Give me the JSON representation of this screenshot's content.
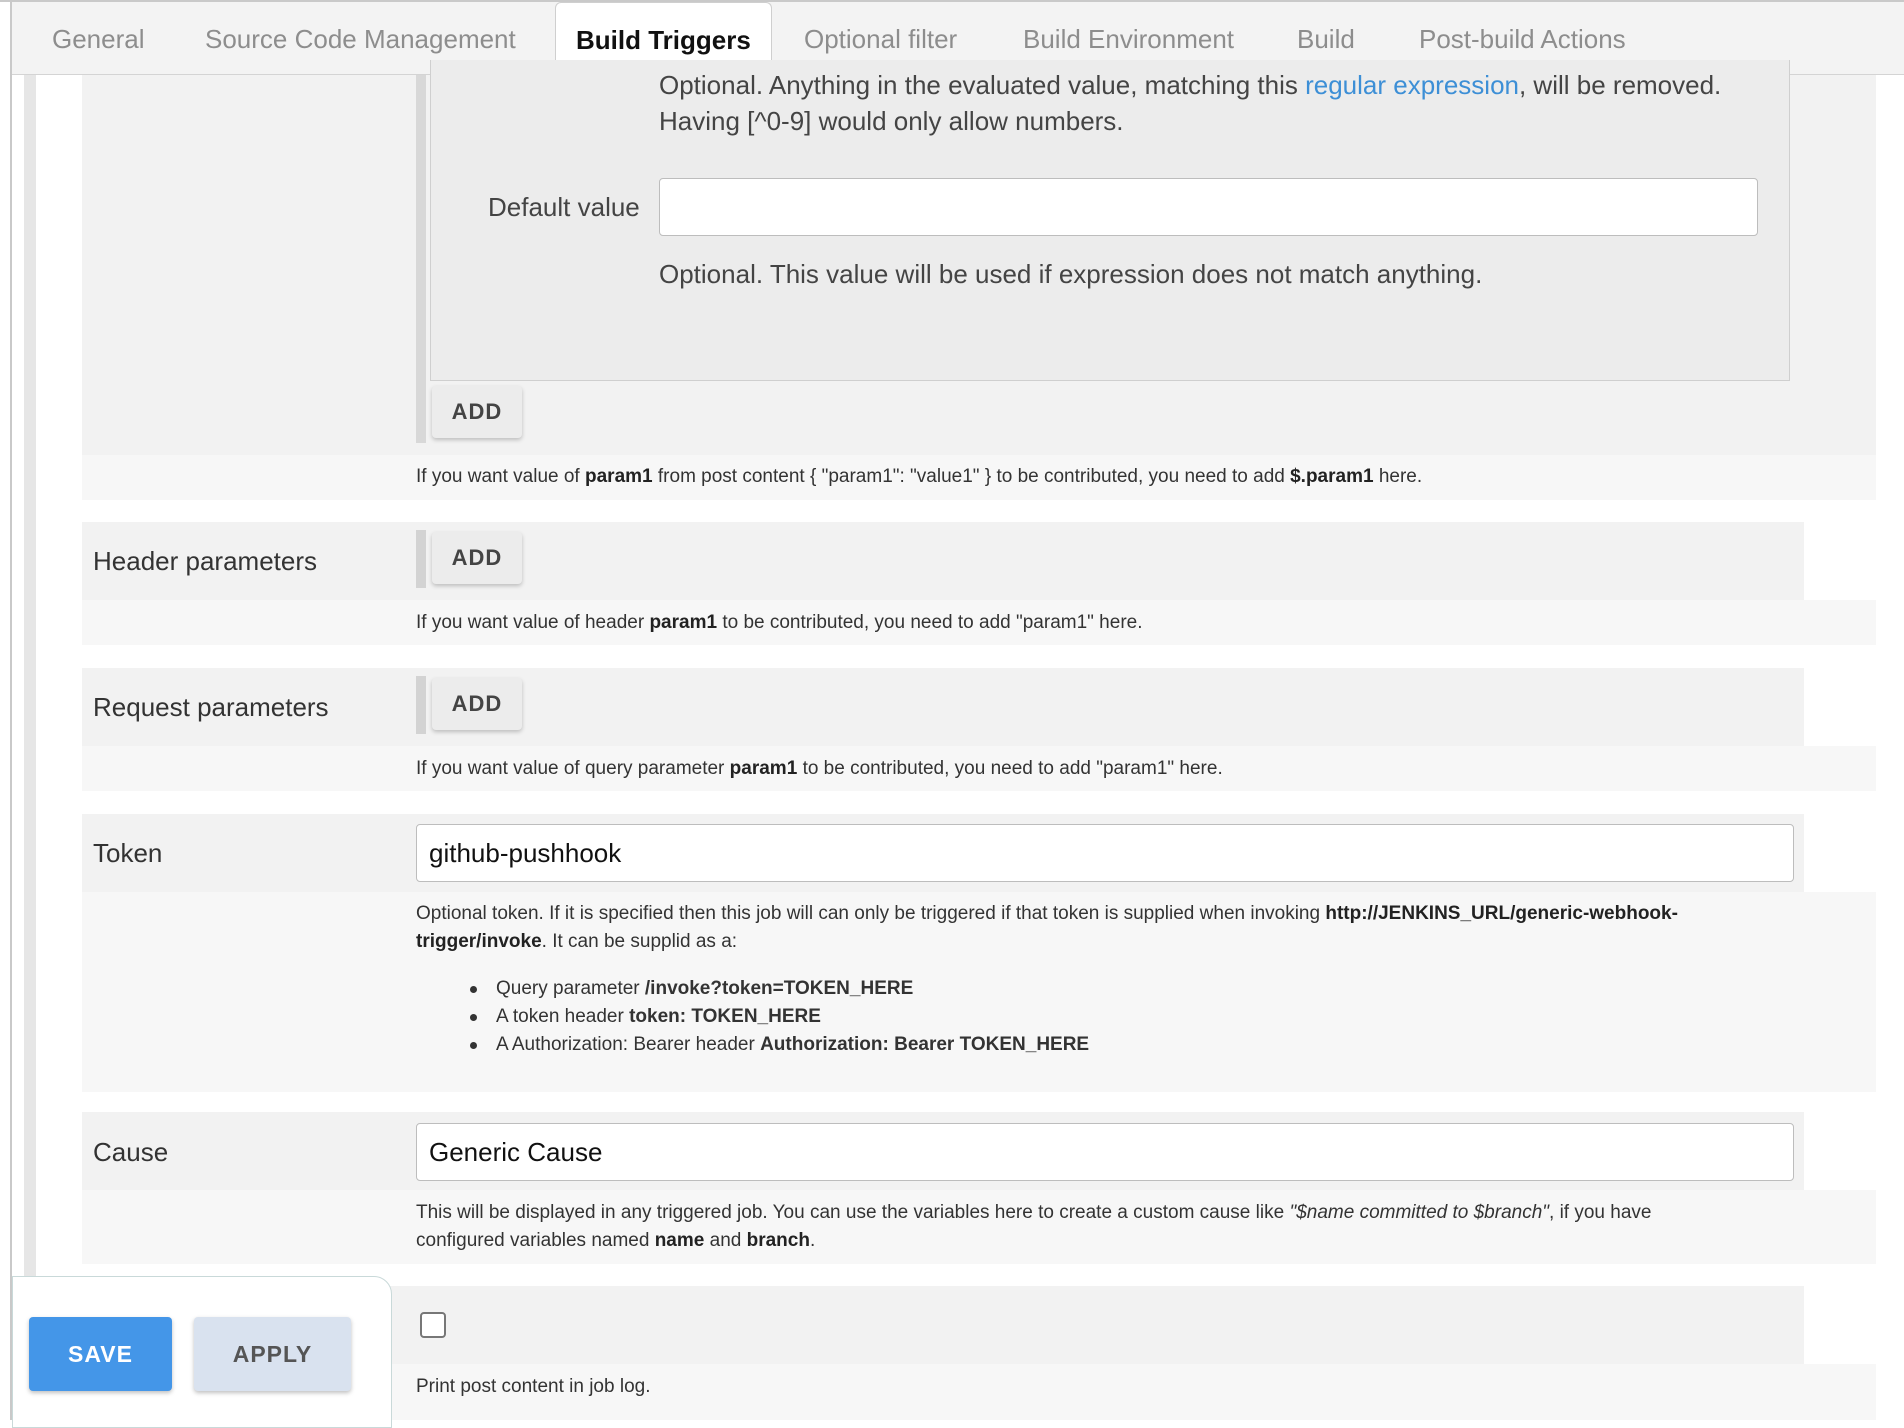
{
  "tabs": [
    {
      "label": "General"
    },
    {
      "label": "Source Code Management"
    },
    {
      "label": "Build Triggers"
    },
    {
      "label": "Optional filter"
    },
    {
      "label": "Build Environment"
    },
    {
      "label": "Build"
    },
    {
      "label": "Post-build Actions"
    }
  ],
  "active_tab": "Build Triggers",
  "post_params": {
    "regex_help_prefix": "Optional. Anything in the evaluated value, matching this",
    "regex_link": "regular expression",
    "regex_help_suffix": ", will be removed.",
    "regex_help_line2": "Having [^0-9] would only allow numbers.",
    "default_value_label": "Default value",
    "default_value": "",
    "default_value_help": "Optional. This value will be used if expression does not match anything.",
    "add_label": "ADD",
    "help_prefix": "If you want value of",
    "help_bold1": "param1",
    "help_mid": "from post content { \"param1\": \"value1\" } to be contributed, you need to add",
    "help_bold2": "$.param1",
    "help_suffix": "here."
  },
  "header_params": {
    "label": "Header parameters",
    "add_label": "ADD",
    "help_prefix": "If you want value of header",
    "help_bold": "param1",
    "help_suffix": "to be contributed, you need to add \"param1\" here."
  },
  "request_params": {
    "label": "Request parameters",
    "add_label": "ADD",
    "help_prefix": "If you want value of query parameter",
    "help_bold": "param1",
    "help_suffix": "to be contributed, you need to add \"param1\" here."
  },
  "token": {
    "label": "Token",
    "value": "github-pushhook",
    "help_prefix": "Optional token. If it is specified then this job will can only be triggered if that token is supplied when invoking",
    "help_bold_url1": "http://JENKINS_URL/generic-webhook-",
    "help_bold_url2": "trigger/invoke",
    "help_suffix": ". It can be supplid as a:",
    "items": [
      {
        "prefix": "Query parameter",
        "bold": "/invoke?token=TOKEN_HERE"
      },
      {
        "prefix": "A token header",
        "bold": "token: TOKEN_HERE"
      },
      {
        "prefix": "A Authorization: Bearer header",
        "bold": "Authorization: Bearer TOKEN_HERE"
      }
    ]
  },
  "cause": {
    "label": "Cause",
    "value": "Generic Cause",
    "help_prefix": "This will be displayed in any triggered job. You can use the variables here to create a custom cause like",
    "help_italic": "\"$name committed to $branch\"",
    "help_mid": ", if you have",
    "help_line2_prefix": "configured variables named",
    "help_bold_name": "name",
    "help_and": "and",
    "help_bold_branch": "branch",
    "help_end": "."
  },
  "print_post": {
    "checked": false,
    "label": "Print post content in job log."
  },
  "actions": {
    "save_label": "SAVE",
    "apply_label": "APPLY"
  },
  "colors": {
    "save_button": "#4496e8",
    "apply_button": "#d9e2ef",
    "link": "#3d8fd6"
  }
}
